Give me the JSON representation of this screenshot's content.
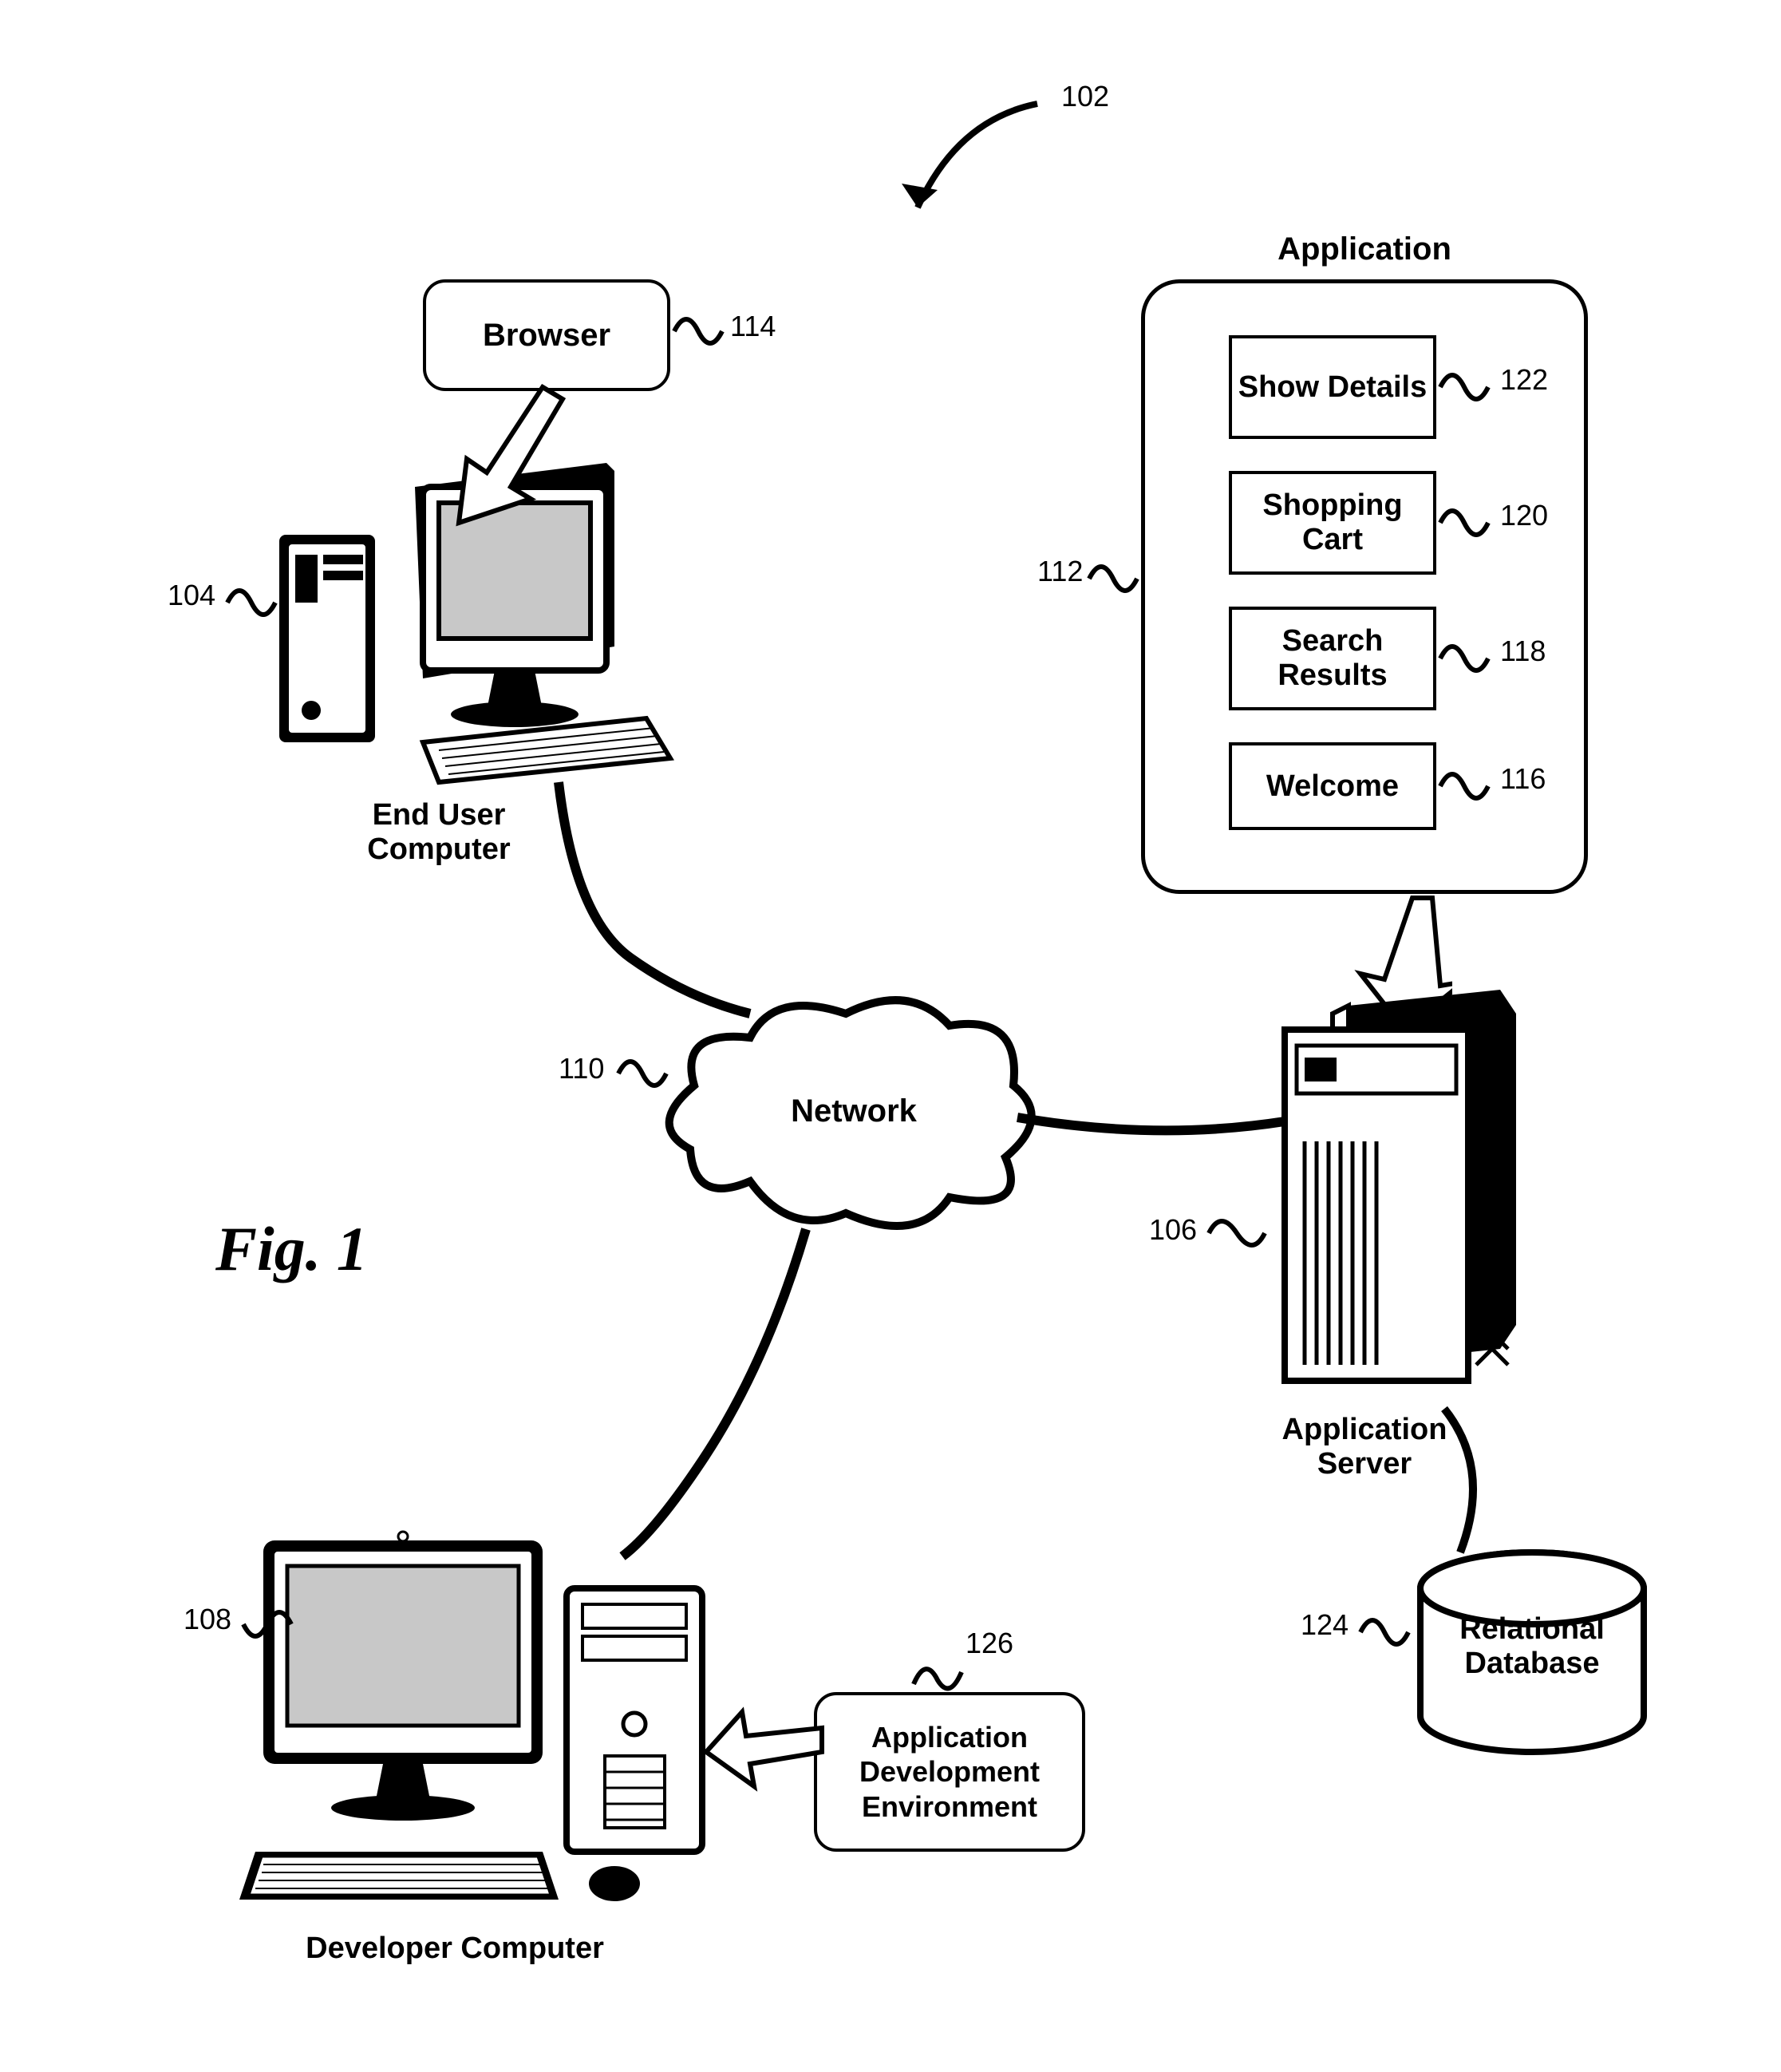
{
  "figure_number": "Fig. 1",
  "refs": {
    "system": "102",
    "end_user": "104",
    "app_server": "106",
    "developer": "108",
    "network": "110",
    "application_container": "112",
    "browser_callout": "114",
    "welcome": "116",
    "search_results": "118",
    "shopping_cart": "120",
    "show_details": "122",
    "database": "124",
    "ade_callout": "126"
  },
  "labels": {
    "browser": "Browser",
    "network": "Network",
    "end_user_computer": "End User Computer",
    "developer_computer": "Developer Computer",
    "application_server": "Application Server",
    "application": "Application",
    "relational_database": "Relational Database",
    "show_details": "Show Details",
    "shopping_cart": "Shopping Cart",
    "search_results": "Search Results",
    "welcome": "Welcome",
    "app_dev_env": "Application Development Environment"
  }
}
